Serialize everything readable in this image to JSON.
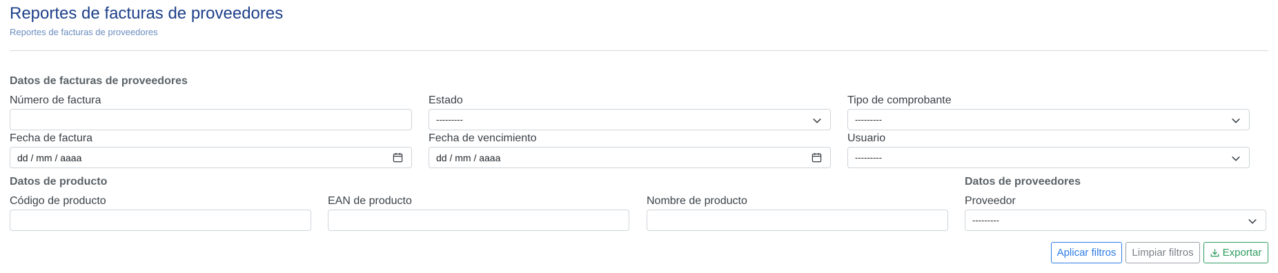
{
  "header": {
    "title": "Reportes de facturas de proveedores",
    "subtitle": "Reportes de facturas de proveedores"
  },
  "sections": {
    "invoice_data": "Datos de facturas de proveedores",
    "product_data": "Datos de producto",
    "supplier_data": "Datos de proveedores"
  },
  "fields": {
    "invoice_number": {
      "label": "Número de factura",
      "value": ""
    },
    "status": {
      "label": "Estado",
      "value": "---------"
    },
    "voucher_type": {
      "label": "Tipo de comprobante",
      "value": "---------"
    },
    "invoice_date": {
      "label": "Fecha de factura",
      "placeholder": "dd / mm / aaaa"
    },
    "due_date": {
      "label": "Fecha de vencimiento",
      "placeholder": "dd / mm / aaaa"
    },
    "user": {
      "label": "Usuario",
      "value": "---------"
    },
    "product_code": {
      "label": "Código de producto",
      "value": ""
    },
    "product_ean": {
      "label": "EAN de producto",
      "value": ""
    },
    "product_name": {
      "label": "Nombre de producto",
      "value": ""
    },
    "supplier": {
      "label": "Proveedor",
      "value": "---------"
    }
  },
  "actions": {
    "apply": "Aplicar filtros",
    "clear": "Limpiar filtros",
    "export": "Exportar"
  },
  "icons": {
    "select": "chevron-down-icon",
    "date": "calendar-icon",
    "export": "download-icon"
  },
  "colors": {
    "title": "#1d3f8a",
    "subtitle": "#6a8cbf",
    "primary": "#2c7be5",
    "secondary": "#7b8187",
    "success": "#2e9c5f"
  }
}
